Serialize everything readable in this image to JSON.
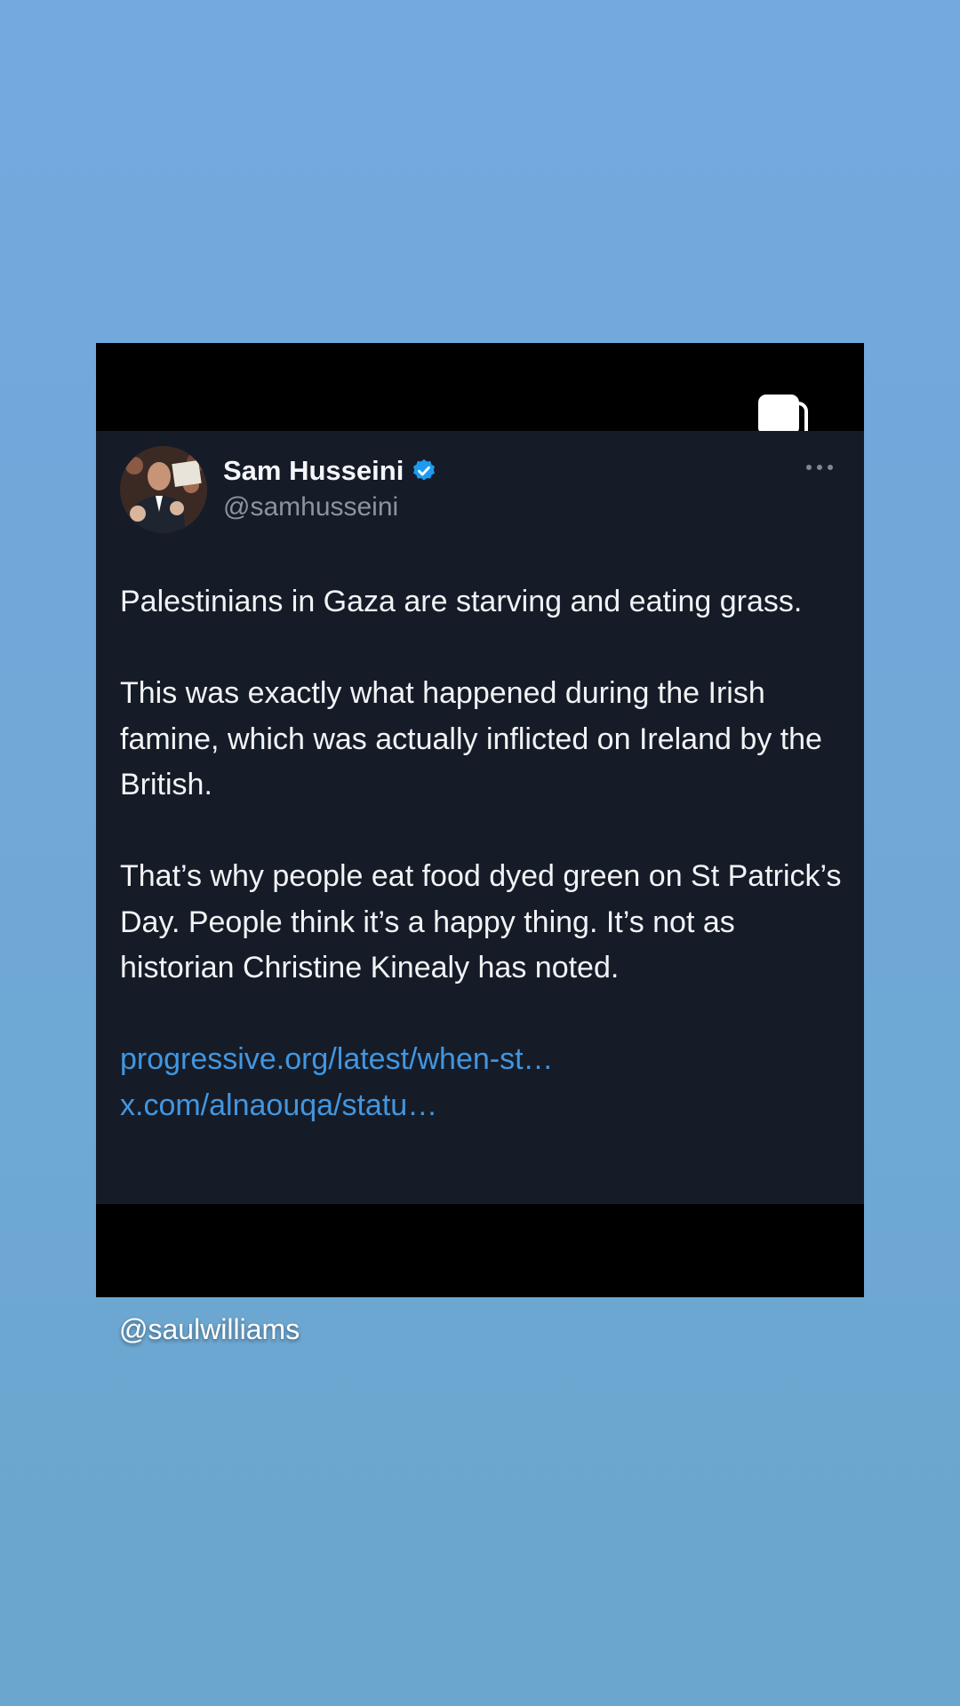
{
  "post": {
    "author": {
      "name": "Sam Husseini",
      "handle": "@samhusseini",
      "verified": true,
      "verified_color": "#1d9bf0"
    },
    "paragraphs": [
      "Palestinians in Gaza are starving and eating grass.",
      "This was exactly what happened during the Irish famine, which was actually inflicted on Ireland by the British.",
      "That’s why people eat food dyed green on St Patrick’s Day. People think it’s a happy thing. It’s not as historian Christine Kinealy has noted."
    ],
    "links": [
      "progressive.org/latest/when-st…",
      "x.com/alnaouqa/statu…"
    ],
    "link_color": "#4296e0",
    "card_background": "#151c28"
  },
  "story": {
    "caption": "@saulwilliams",
    "icons": {
      "multi_select": "copy-stack-icon",
      "more": "more-horizontal-icon",
      "verified": "verified-badge-icon"
    }
  }
}
